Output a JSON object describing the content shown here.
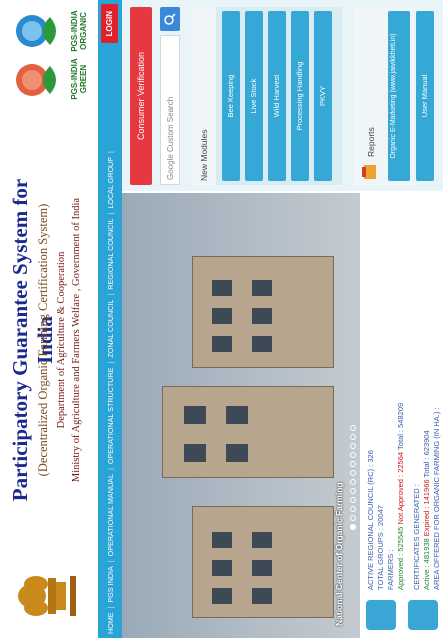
{
  "header": {
    "title": "Participatory Guarantee System for India",
    "subtitle": "(Decentralized Organic Farming Certification System)",
    "department": "Department of Agriculture & Cooperation",
    "ministry": "Ministry of Agriculture and Farmers Welfare , Government of India",
    "logo_green_text": "PGS-INDIA GREEN",
    "logo_organic_text": "PGS-INDIA ORGANIC"
  },
  "nav": {
    "items": [
      "HOME",
      "PGS INDIA",
      "OPERATIONAL MANUAL",
      "OPERATIONAL STRUCTURE",
      "ZONAL COUNCIL",
      "REGIONAL COUNCIL",
      "LOCAL GROUP"
    ],
    "login": "LOGIN"
  },
  "hero": {
    "caption": "National Center of Organic Farming"
  },
  "sidebar": {
    "consumer_verification": "Consumer Verification",
    "search_placeholder": "Google Custom Search",
    "new_modules_label": "New Modules",
    "modules": [
      "Bee Keeping",
      "Live Stock",
      "Wild Harvest",
      "Processing Handling",
      "PKVY"
    ],
    "reports_label": "Reports",
    "report_buttons": [
      "Organic E-Marketing (www.jaivikkheti.in)",
      "User Manual"
    ]
  },
  "stats": {
    "rc_label": "ACTIVE REGIONAL COUNCIL (RC) :",
    "rc_value": "326",
    "groups_label": "TOTAL GROUPS :",
    "groups_value": "20047",
    "farmers_label": "FARMERS :",
    "farmers_approved_label": "Approved :",
    "farmers_approved": "525545",
    "farmers_not_approved_label": "Not Approved :",
    "farmers_not_approved": "22564",
    "farmers_total_label": "Total :",
    "farmers_total": "548209",
    "cert_label": "CERTIFICATES GENERATED :",
    "cert_active_label": "Active :",
    "cert_active": "481938",
    "cert_expired_label": "Expired :",
    "cert_expired": "141966",
    "cert_total_label": "Total :",
    "cert_total": "623904",
    "area_label": "AREA OFFERED FOR ORGANIC FARMING (IN HA.) :"
  },
  "colors": {
    "nav_bg": "#2aa3d6",
    "title": "#1a2a8e",
    "login": "#e0202a",
    "module_btn": "#35a8d6"
  }
}
